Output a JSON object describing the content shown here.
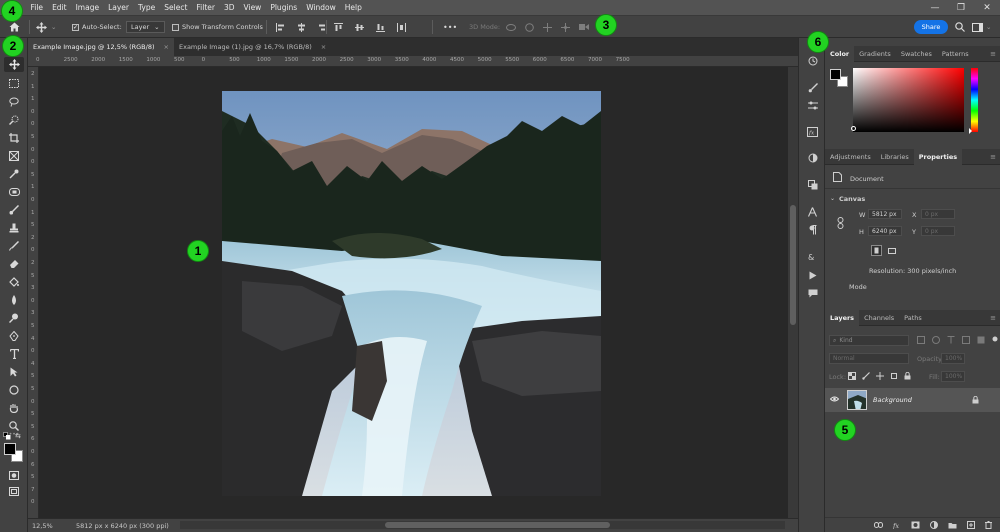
{
  "menu": [
    "File",
    "Edit",
    "Image",
    "Layer",
    "Type",
    "Select",
    "Filter",
    "3D",
    "View",
    "Plugins",
    "Window",
    "Help"
  ],
  "options_bar": {
    "auto_select_label": "Auto-Select:",
    "auto_select_value": "Layer",
    "show_transform_label": "Show Transform Controls",
    "more": "•••",
    "mode_3d_label": "3D Mode:",
    "share_label": "Share"
  },
  "tabs": [
    {
      "label": "Example Image.jpg @ 12,5% (RGB/8)",
      "close": "×"
    },
    {
      "label": "Example Image (1).jpg @ 16,7% (RGB/8)",
      "close": "×"
    }
  ],
  "ruler": {
    "top": [
      "0",
      "2500",
      "2000",
      "1500",
      "1000",
      "500",
      "0",
      "500",
      "1000",
      "1500",
      "2000",
      "2500",
      "3000",
      "3500",
      "4000",
      "4500",
      "5000",
      "5500",
      "6000",
      "6500",
      "7000",
      "7500"
    ],
    "left": [
      "2",
      "1",
      "1",
      "0",
      "0",
      "5",
      "0",
      "0",
      "5",
      "1",
      "0",
      "1",
      "5",
      "2",
      "0",
      "2",
      "5",
      "3",
      "0",
      "3",
      "5",
      "4",
      "0",
      "4",
      "5",
      "5",
      "0",
      "5",
      "5",
      "6",
      "0",
      "6",
      "5",
      "7",
      "0"
    ]
  },
  "status": {
    "zoom": "12,5%",
    "doc_info": "5812 px x 6240 px (300 ppi)",
    "arrow": "›"
  },
  "panels": {
    "color_tabs": [
      "Color",
      "Gradients",
      "Swatches",
      "Patterns"
    ],
    "adjust_tabs": [
      "Adjustments",
      "Libraries",
      "Properties"
    ],
    "properties": {
      "document_label": "Document",
      "canvas_heading": "Canvas",
      "w_label": "W",
      "w_value": "5812 px",
      "h_label": "H",
      "h_value": "6240 px",
      "x_label": "X",
      "x_value": "0 px",
      "y_label": "Y",
      "y_value": "0 px",
      "resolution": "Resolution: 300 pixels/inch",
      "mode_label": "Mode"
    },
    "layers_tabs": [
      "Layers",
      "Channels",
      "Paths"
    ],
    "layers": {
      "kind_label": "Kind",
      "blend_mode": "Normal",
      "opacity_label": "Opacity:",
      "opacity_value": "100%",
      "lock_label": "Lock:",
      "fill_label": "Fill:",
      "fill_value": "100%",
      "background_layer": "Background"
    }
  },
  "markers": [
    "1",
    "2",
    "3",
    "4",
    "5",
    "6"
  ],
  "colors": {
    "accent": "#1473e6",
    "marker": "#22d322",
    "panel": "#424242",
    "canvas": "#282828"
  }
}
